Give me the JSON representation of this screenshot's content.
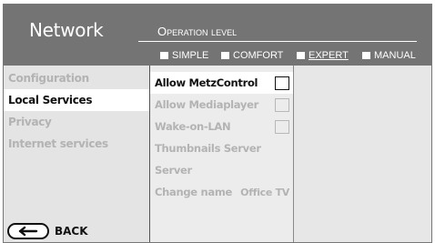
{
  "header": {
    "title": "Network",
    "operation_level_label": "Operation level",
    "options": [
      {
        "label": "SIMPLE",
        "active": false
      },
      {
        "label": "COMFORT",
        "active": false
      },
      {
        "label": "EXPERT",
        "active": true
      },
      {
        "label": "MANUAL",
        "active": false
      }
    ]
  },
  "sidebar": {
    "items": [
      {
        "label": "Configuration",
        "selected": false
      },
      {
        "label": "Local Services",
        "selected": true
      },
      {
        "label": "Privacy",
        "selected": false
      },
      {
        "label": "Internet services",
        "selected": false
      }
    ],
    "back_label": "BACK"
  },
  "settings": {
    "items": [
      {
        "label": "Allow MetzControl",
        "control": "checkbox",
        "checked": false,
        "selected": true
      },
      {
        "label": "Allow Mediaplayer",
        "control": "checkbox",
        "checked": false,
        "selected": false
      },
      {
        "label": "Wake-on-LAN",
        "control": "checkbox",
        "checked": false,
        "selected": false
      },
      {
        "label": "Thumbnails Server",
        "control": "none",
        "selected": false
      },
      {
        "label": "Server",
        "control": "none",
        "selected": false
      },
      {
        "label": "Change name",
        "control": "value",
        "value": "Office TV",
        "selected": false
      }
    ]
  },
  "colors": {
    "header_bg": "#747474",
    "panel_bg": "#e9e9e9",
    "selected_bg": "#ffffff",
    "inactive_text": "#b3b3b3",
    "active_text": "#111111"
  }
}
